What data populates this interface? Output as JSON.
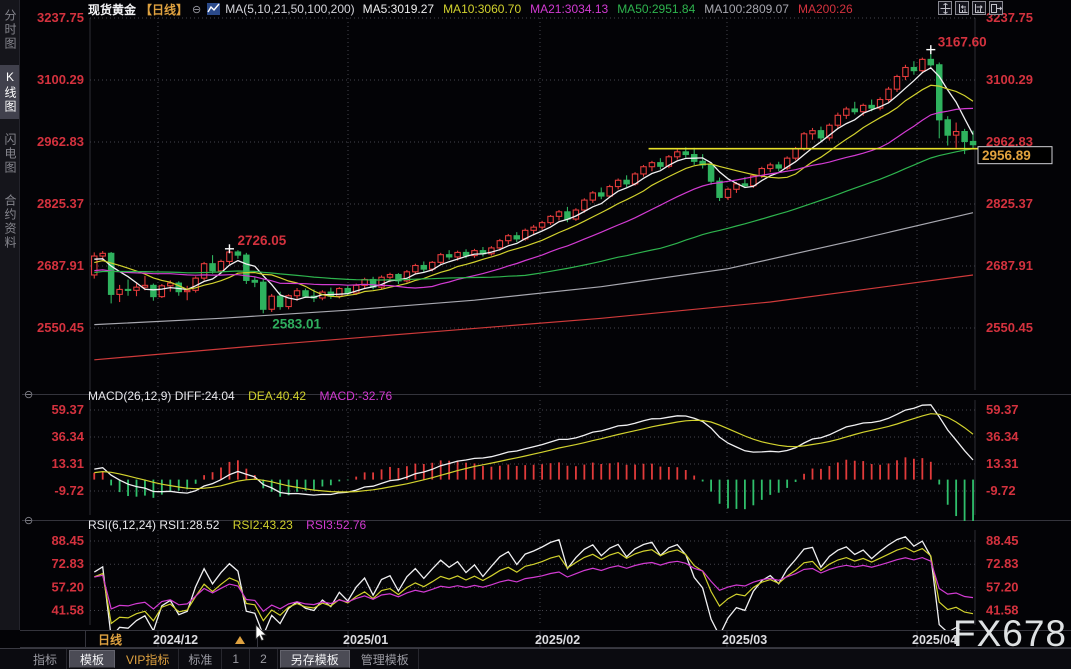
{
  "ui": {
    "collapse_icon": "⊖"
  },
  "header": {
    "symbol": "现货黄金",
    "period_tag": "【日线】",
    "ma_setting": "MA(5,10,21,50,100,200)",
    "ma_values": [
      {
        "label": "MA5:3019.27",
        "color": "#eeeeee"
      },
      {
        "label": "MA10:3060.70",
        "color": "#d2d22e"
      },
      {
        "label": "MA21:3034.13",
        "color": "#d23bd2"
      },
      {
        "label": "MA50:2951.84",
        "color": "#2eb44e"
      },
      {
        "label": "MA100:2809.07",
        "color": "#a8a8b0"
      },
      {
        "label": "MA200:26",
        "color": "#d4323e"
      }
    ],
    "icons": [
      "crosshair-move",
      "chart-pan-left",
      "chart-pan-right",
      "expand-panel"
    ]
  },
  "sidebar": {
    "items": [
      {
        "label": "分时图",
        "active": false
      },
      {
        "label": "K线图",
        "active": true
      },
      {
        "label": "闪电图",
        "active": false
      },
      {
        "label": "合约资料",
        "active": false
      }
    ]
  },
  "bottom": {
    "period_label": "日线",
    "tabs": [
      {
        "label": "指标",
        "style": "plain"
      },
      {
        "label": "模板",
        "style": "raised"
      },
      {
        "label": "VIP指标",
        "style": "vip"
      },
      {
        "label": "标准",
        "style": "plain"
      },
      {
        "label": "1",
        "style": "plain"
      },
      {
        "label": "2",
        "style": "plain"
      },
      {
        "label": "另存模板",
        "style": "raised"
      },
      {
        "label": "管理模板",
        "style": "plain"
      }
    ]
  },
  "watermark": {
    "text": "FX678"
  },
  "chart_data": {
    "type": "candlestick",
    "title": "现货黄金 日线",
    "grid_color": "#45454d",
    "axis_label_color": "#d4323e",
    "x_axis": {
      "month_ticks": [
        {
          "idx": 7.54,
          "label": "2024/12"
        },
        {
          "idx": 30.03,
          "label": "2025/01"
        },
        {
          "idx": 52.75,
          "label": "2025/02"
        },
        {
          "idx": 74.88,
          "label": "2025/03"
        },
        {
          "idx": 97.37,
          "label": "2025/04"
        }
      ]
    },
    "main": {
      "ylim": [
        2413.0,
        3237.75
      ],
      "grid_values": [
        3237.75,
        3100.29,
        2962.83,
        2825.37,
        2687.91,
        2550.45
      ],
      "candle_up_color": "#e23b3b",
      "candle_down_color": "#2fb25e",
      "ma_defs": [
        {
          "period": 5,
          "color": "#f0f0f2"
        },
        {
          "period": 10,
          "color": "#d2d22e"
        },
        {
          "period": 21,
          "color": "#d23bd2"
        },
        {
          "period": 50,
          "color": "#2eb44e"
        }
      ],
      "ma_long": [
        {
          "name": "MA100",
          "color": "#a8a8b0",
          "points": [
            [
              0,
              2558
            ],
            [
              15,
              2572
            ],
            [
              30,
              2590
            ],
            [
              45,
              2612
            ],
            [
              60,
              2642
            ],
            [
              75,
              2682
            ],
            [
              90,
              2745
            ],
            [
              104,
              2806
            ]
          ]
        },
        {
          "name": "MA200",
          "color": "#cf3a3a",
          "points": [
            [
              0,
              2480
            ],
            [
              20,
              2512
            ],
            [
              40,
              2542
            ],
            [
              60,
              2572
            ],
            [
              80,
              2608
            ],
            [
              104,
              2668
            ]
          ]
        }
      ],
      "annotations": {
        "high": {
          "idx": 99,
          "price": 3167.6,
          "label": "3167.60",
          "color": "#d4323e",
          "marker_color": "#ffffff"
        },
        "prev_high": {
          "idx": 16,
          "price": 2726.05,
          "label": "2726.05",
          "color": "#d4323e",
          "marker_color": "#ffffff"
        },
        "low": {
          "idx": 20,
          "price": 2583.01,
          "label": "2583.01",
          "color": "#2fae5e"
        },
        "last_price": {
          "label": "2956.89",
          "value": 2956.89,
          "color": "#e2a23e"
        },
        "hline": {
          "price": 2948,
          "from_idx": 65.6,
          "color": "#e6df2a"
        }
      }
    },
    "candles": [
      [
        2668,
        2718,
        2660,
        2710
      ],
      [
        2710,
        2721,
        2698,
        2716
      ],
      [
        2716,
        2719,
        2605,
        2625
      ],
      [
        2625,
        2646,
        2608,
        2636
      ],
      [
        2636,
        2658,
        2622,
        2634
      ],
      [
        2634,
        2652,
        2621,
        2641
      ],
      [
        2641,
        2666,
        2634,
        2645
      ],
      [
        2645,
        2649,
        2611,
        2620
      ],
      [
        2620,
        2648,
        2617,
        2644
      ],
      [
        2644,
        2656,
        2631,
        2650
      ],
      [
        2650,
        2654,
        2622,
        2631
      ],
      [
        2631,
        2644,
        2612,
        2634
      ],
      [
        2634,
        2665,
        2629,
        2661
      ],
      [
        2661,
        2697,
        2656,
        2693
      ],
      [
        2693,
        2712,
        2671,
        2677
      ],
      [
        2677,
        2702,
        2672,
        2698
      ],
      [
        2698,
        2726.05,
        2692,
        2719
      ],
      [
        2719,
        2723,
        2704,
        2712
      ],
      [
        2712,
        2717,
        2648,
        2656
      ],
      [
        2656,
        2664,
        2641,
        2652
      ],
      [
        2652,
        2658,
        2583.01,
        2592
      ],
      [
        2592,
        2626,
        2586,
        2621
      ],
      [
        2621,
        2631,
        2591,
        2598
      ],
      [
        2598,
        2625,
        2592,
        2622
      ],
      [
        2622,
        2639,
        2611,
        2633
      ],
      [
        2633,
        2638,
        2617,
        2621
      ],
      [
        2621,
        2636,
        2608,
        2617
      ],
      [
        2617,
        2634,
        2612,
        2630
      ],
      [
        2630,
        2640,
        2615,
        2621
      ],
      [
        2621,
        2641,
        2616,
        2638
      ],
      [
        2638,
        2644,
        2622,
        2628
      ],
      [
        2628,
        2649,
        2624,
        2645
      ],
      [
        2645,
        2662,
        2638,
        2658
      ],
      [
        2658,
        2664,
        2636,
        2641
      ],
      [
        2641,
        2667,
        2637,
        2663
      ],
      [
        2663,
        2673,
        2652,
        2669
      ],
      [
        2669,
        2672,
        2648,
        2655
      ],
      [
        2655,
        2679,
        2651,
        2675
      ],
      [
        2675,
        2693,
        2670,
        2689
      ],
      [
        2689,
        2698,
        2674,
        2681
      ],
      [
        2681,
        2699,
        2676,
        2696
      ],
      [
        2696,
        2717,
        2692,
        2713
      ],
      [
        2713,
        2723,
        2702,
        2708
      ],
      [
        2708,
        2722,
        2700,
        2718
      ],
      [
        2718,
        2725,
        2705,
        2711
      ],
      [
        2711,
        2726,
        2706,
        2722
      ],
      [
        2722,
        2730,
        2709,
        2715
      ],
      [
        2715,
        2732,
        2711,
        2728
      ],
      [
        2728,
        2748,
        2722,
        2744
      ],
      [
        2744,
        2759,
        2736,
        2755
      ],
      [
        2755,
        2763,
        2741,
        2748
      ],
      [
        2748,
        2771,
        2744,
        2767
      ],
      [
        2767,
        2779,
        2756,
        2774
      ],
      [
        2774,
        2788,
        2768,
        2784
      ],
      [
        2784,
        2801,
        2779,
        2798
      ],
      [
        2798,
        2812,
        2789,
        2808
      ],
      [
        2808,
        2819,
        2785,
        2792
      ],
      [
        2792,
        2816,
        2788,
        2812
      ],
      [
        2812,
        2838,
        2806,
        2834
      ],
      [
        2834,
        2854,
        2828,
        2850
      ],
      [
        2850,
        2862,
        2836,
        2843
      ],
      [
        2843,
        2868,
        2840,
        2864
      ],
      [
        2864,
        2882,
        2858,
        2878
      ],
      [
        2878,
        2889,
        2863,
        2870
      ],
      [
        2870,
        2896,
        2866,
        2892
      ],
      [
        2892,
        2912,
        2886,
        2908
      ],
      [
        2908,
        2921,
        2898,
        2917
      ],
      [
        2917,
        2927,
        2902,
        2909
      ],
      [
        2909,
        2934,
        2905,
        2930
      ],
      [
        2930,
        2946,
        2924,
        2941
      ],
      [
        2941,
        2951,
        2928,
        2935
      ],
      [
        2935,
        2950,
        2912,
        2920
      ],
      [
        2920,
        2936,
        2904,
        2912
      ],
      [
        2912,
        2918,
        2868,
        2876
      ],
      [
        2876,
        2884,
        2832,
        2840
      ],
      [
        2840,
        2862,
        2834,
        2858
      ],
      [
        2858,
        2874,
        2850,
        2870
      ],
      [
        2870,
        2885,
        2862,
        2866
      ],
      [
        2866,
        2892,
        2861,
        2888
      ],
      [
        2888,
        2908,
        2883,
        2904
      ],
      [
        2904,
        2917,
        2896,
        2912
      ],
      [
        2912,
        2919,
        2898,
        2905
      ],
      [
        2905,
        2931,
        2901,
        2927
      ],
      [
        2927,
        2952,
        2922,
        2948
      ],
      [
        2948,
        2985,
        2944,
        2981
      ],
      [
        2981,
        2994,
        2968,
        2988
      ],
      [
        2988,
        2997,
        2962,
        2972
      ],
      [
        2972,
        3004,
        2966,
        3000
      ],
      [
        3000,
        3028,
        2994,
        3022
      ],
      [
        3022,
        3041,
        3014,
        3036
      ],
      [
        3036,
        3052,
        3024,
        3030
      ],
      [
        3030,
        3048,
        3021,
        3044
      ],
      [
        3044,
        3057,
        3031,
        3038
      ],
      [
        3038,
        3062,
        3033,
        3057
      ],
      [
        3057,
        3085,
        3052,
        3080
      ],
      [
        3080,
        3112,
        3074,
        3108
      ],
      [
        3108,
        3134,
        3100,
        3128
      ],
      [
        3128,
        3142,
        3112,
        3121
      ],
      [
        3121,
        3150,
        3115,
        3146
      ],
      [
        3146,
        3167.6,
        3130,
        3134
      ],
      [
        3134,
        3139,
        2971,
        3012
      ],
      [
        3012,
        3020,
        2955,
        2978
      ],
      [
        2978,
        3006,
        2950,
        2986
      ],
      [
        2986,
        2992,
        2936,
        2964
      ],
      [
        2964,
        2988,
        2948,
        2956.89
      ]
    ],
    "prehistory_closes": [
      2615,
      2624,
      2630,
      2638,
      2645,
      2652,
      2648,
      2656,
      2662,
      2668,
      2674,
      2666,
      2658,
      2650,
      2655,
      2663,
      2670,
      2676,
      2682,
      2688,
      2694,
      2700,
      2706,
      2712,
      2718,
      2710,
      2702,
      2696,
      2690,
      2684,
      2678,
      2672,
      2666,
      2660,
      2654,
      2648,
      2642,
      2650,
      2658,
      2665,
      2672,
      2680,
      2688,
      2696,
      2704,
      2712,
      2705,
      2698,
      2690
    ],
    "macd_panel": {
      "header": [
        {
          "text": "MACD(26,12,9) DIFF:24.04",
          "color": "#e8e8ec"
        },
        {
          "text": "DEA:40.42",
          "color": "#d2d22e"
        },
        {
          "text": "MACD:-32.76",
          "color": "#d23bd2"
        }
      ],
      "params": [
        26,
        12,
        9
      ],
      "ylim": [
        -30.2,
        67.9
      ],
      "grid_values": [
        59.37,
        36.34,
        13.31,
        -9.72
      ],
      "diff_color": "#f0f0f2",
      "dea_color": "#d2d22e",
      "hist_up": "#e23b3b",
      "hist_down": "#2fbf6b"
    },
    "rsi_panel": {
      "header": [
        {
          "text": "RSI(6,12,24) RSI1:28.52",
          "color": "#e8e8ec"
        },
        {
          "text": "RSI2:43.23",
          "color": "#d2d22e"
        },
        {
          "text": "RSI3:52.76",
          "color": "#d23bd2"
        }
      ],
      "ylim": [
        31.8,
        95.9
      ],
      "grid_values": [
        88.45,
        72.83,
        57.2,
        41.58
      ],
      "series": [
        {
          "period": 6,
          "color": "#f0f0f2"
        },
        {
          "period": 12,
          "color": "#d2d22e"
        },
        {
          "period": 24,
          "color": "#d23bd2"
        }
      ]
    }
  }
}
